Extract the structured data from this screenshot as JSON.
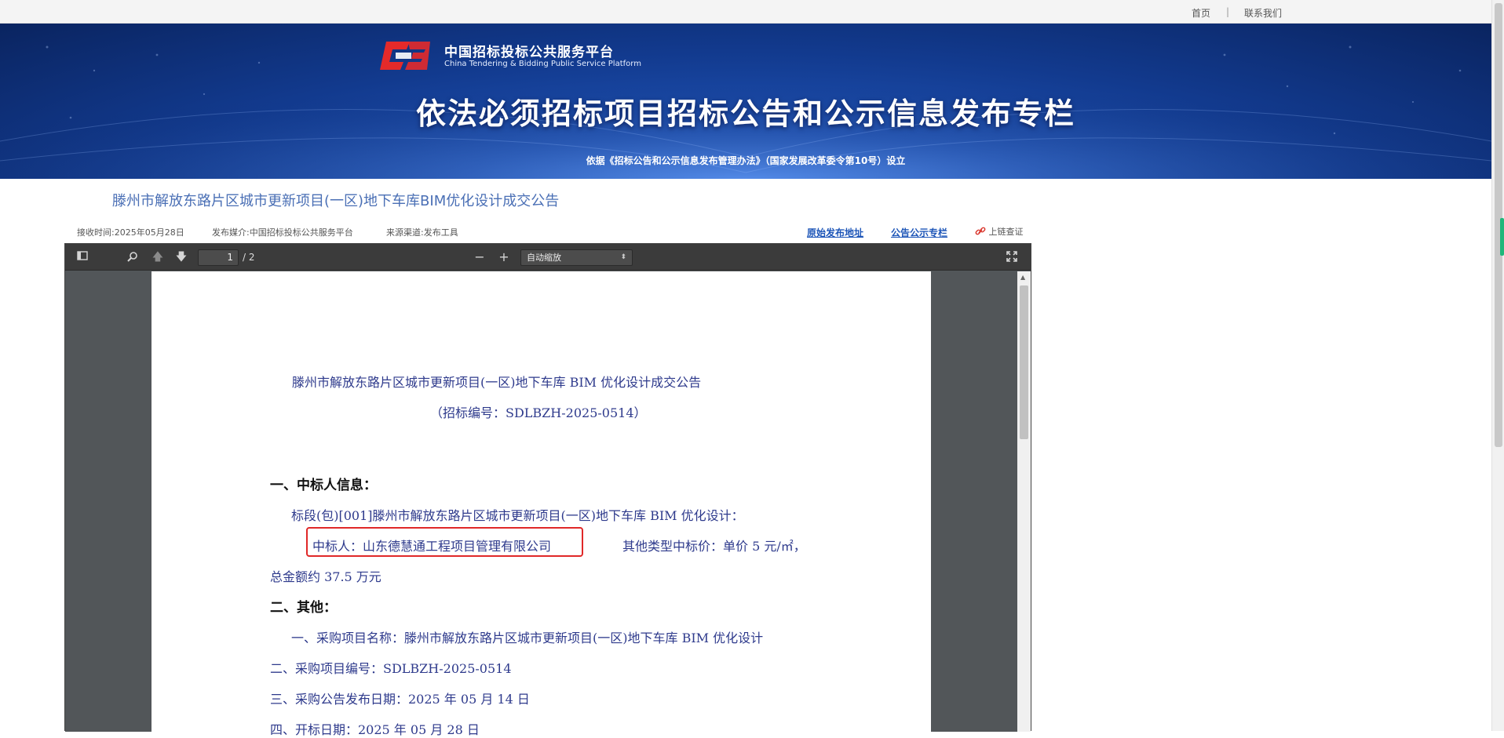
{
  "topbar": {
    "home": "首页",
    "separator": "|",
    "contact": "联系我们"
  },
  "banner": {
    "logo_cn": "中国招标投标公共服务平台",
    "logo_en": "China Tendering & Bidding Public Service Platform",
    "title": "依法必须招标项目招标公告和公示信息发布专栏",
    "subtitle": "依据《招标公告和公示信息发布管理办法》（国家发展改革委令第10号）设立"
  },
  "notice": {
    "title": "滕州市解放东路片区城市更新项目(一区)地下车库BIM优化设计成交公告",
    "received": "接收时间:2025年05月28日",
    "media": "发布媒介:中国招标投标公共服务平台",
    "source": "来源渠道:发布工具",
    "original_link": "原始发布地址",
    "column_link": "公告公示专栏",
    "chain_check": "上链查证"
  },
  "viewer": {
    "page_current": "1",
    "page_total": "/ 2",
    "zoom": "自动缩放"
  },
  "pdf": {
    "title": "滕州市解放东路片区城市更新项目(一区)地下车库 BIM 优化设计成交公告",
    "bid_no": "（招标编号：SDLBZH-2025-0514）",
    "section1": "一、中标人信息：",
    "lot": "标段(包)[001]滕州市解放东路片区城市更新项目(一区)地下车库 BIM 优化设计：",
    "winner": "中标人：山东德慧通工程项目管理有限公司",
    "price": "其他类型中标价：单价 5 元/㎡，",
    "total": "总金额约 37.5 万元",
    "section2": "二、其他：",
    "item1": "一、采购项目名称：滕州市解放东路片区城市更新项目(一区)地下车库 BIM 优化设计",
    "item2": "二、采购项目编号：SDLBZH-2025-0514",
    "item3": "三、采购公告发布日期：2025 年 05 月 14 日",
    "item4": "四、开标日期：2025 年 05 月 28 日"
  },
  "colors": {
    "banner_blue": "#1d4fb0",
    "title_blue": "#4a6fb5",
    "link_blue": "#1e56b8",
    "highlight_red": "#e02828",
    "pdf_text": "#2e3a8c"
  },
  "icons": [
    "sidebar-toggle-icon",
    "search-icon",
    "arrow-up-icon",
    "arrow-down-icon",
    "minus-icon",
    "plus-icon",
    "fullscreen-icon",
    "chain-link-icon"
  ]
}
